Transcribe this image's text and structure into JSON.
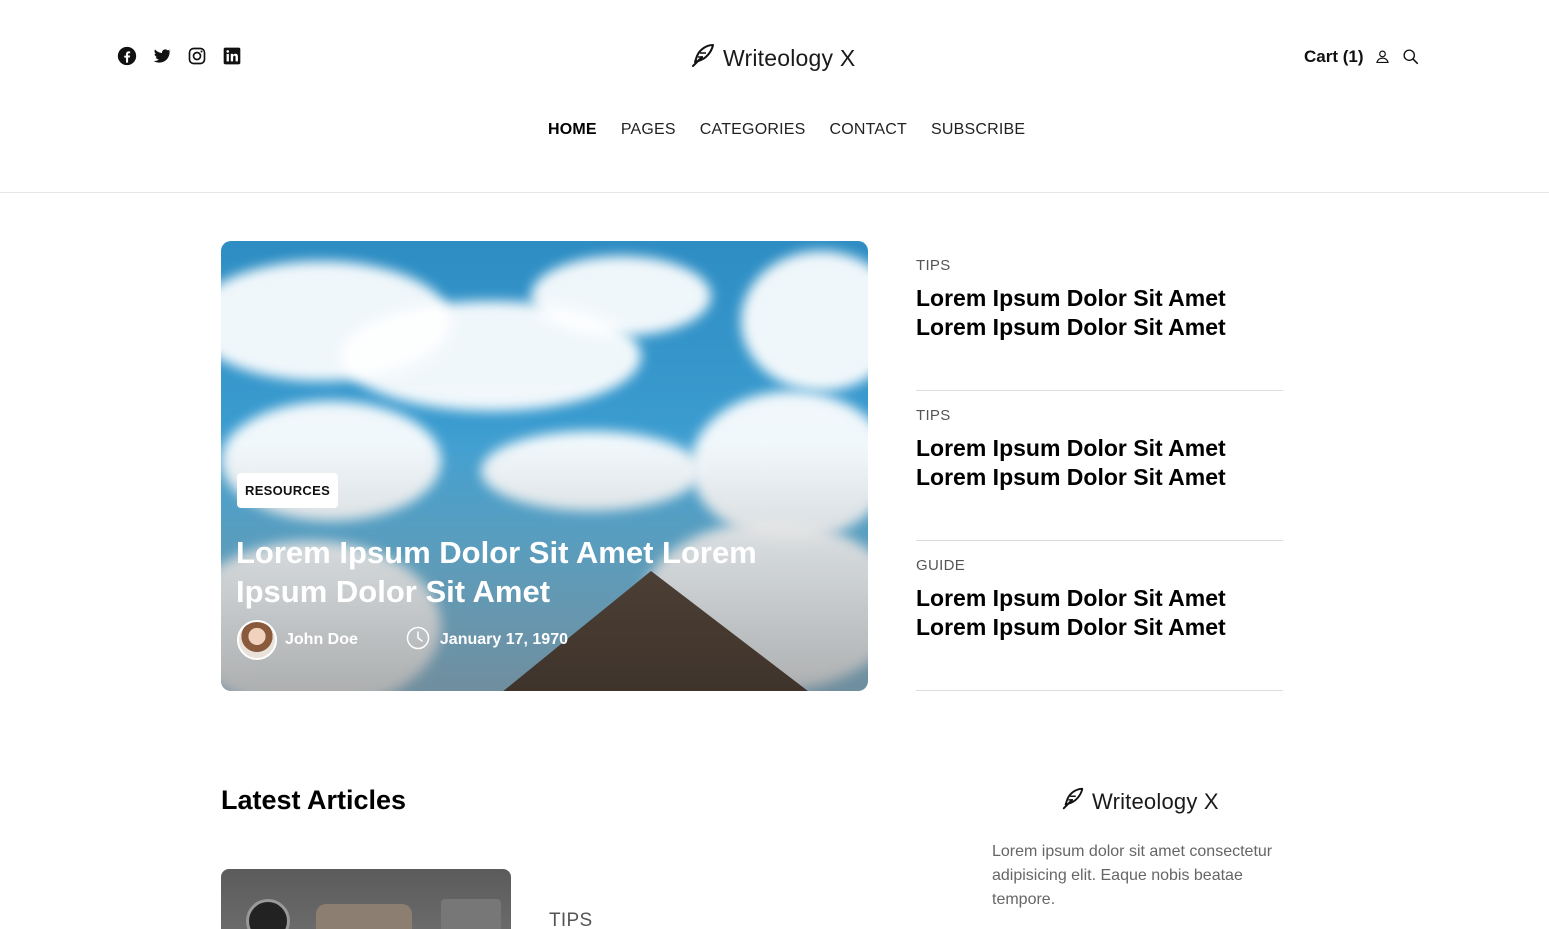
{
  "brand": {
    "name": "Writeology X"
  },
  "social": [
    "facebook-icon",
    "twitter-icon",
    "instagram-icon",
    "linkedin-icon"
  ],
  "header": {
    "cart_label": "Cart (1)"
  },
  "nav": {
    "items": [
      "HOME",
      "PAGES",
      "CATEGORIES",
      "CONTACT",
      "SUBSCRIBE"
    ],
    "active": "HOME"
  },
  "featured": {
    "category": "RESOURCES",
    "title": "Lorem Ipsum Dolor Sit Amet Lorem Ipsum Dolor Sit Amet",
    "author": "John Doe",
    "date": "January 17, 1970"
  },
  "side_posts": [
    {
      "category": "TIPS",
      "title": "Lorem Ipsum Dolor Sit Amet Lorem Ipsum Dolor Sit Amet"
    },
    {
      "category": "TIPS",
      "title": "Lorem Ipsum Dolor Sit Amet Lorem Ipsum Dolor Sit Amet"
    },
    {
      "category": "GUIDE",
      "title": "Lorem Ipsum Dolor Sit Amet Lorem Ipsum Dolor Sit Amet"
    }
  ],
  "latest": {
    "heading": "Latest Articles",
    "first_category": "TIPS"
  },
  "widget": {
    "brand": "Writeology X",
    "description": "Lorem ipsum dolor sit amet consectetur adipisicing elit. Eaque nobis beatae tempore."
  },
  "colors": {
    "text": "#111111",
    "muted": "#666666",
    "divider": "#dcdcdc"
  }
}
